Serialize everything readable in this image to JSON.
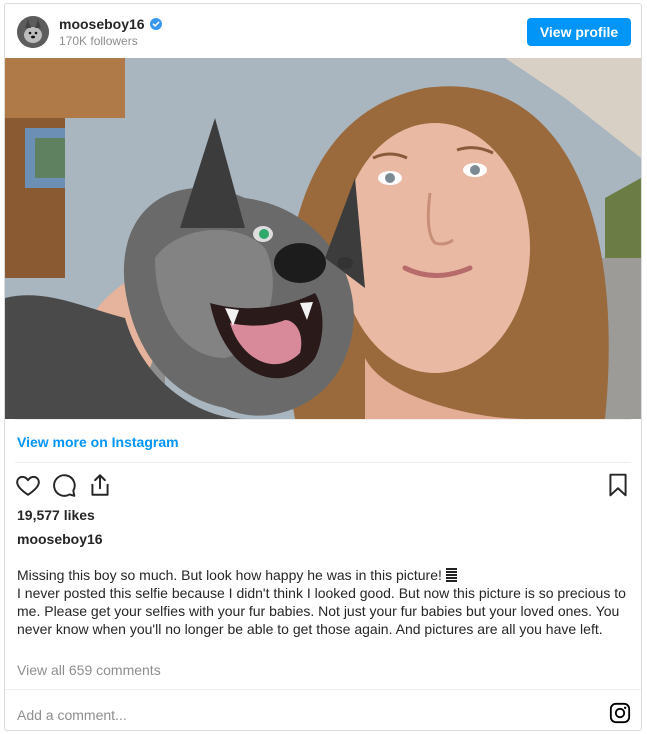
{
  "post": {
    "username": "mooseboy16",
    "followers": "170K followers",
    "view_profile_label": "View profile",
    "view_more_label": "View more on Instagram",
    "likes": "19,577 likes",
    "caption_username": "mooseboy16",
    "caption_line1": "Missing this boy so much. But look how happy he was in this picture!",
    "caption_body": "I never posted this selfie because I didn't think I looked good. But now this picture is so precious to me. Please get your selfies with your fur babies. Not just your fur babies but your loved ones. You never know when you'll no longer be able to get those again. And pictures are all you have left.",
    "view_comments_label": "View all 659 comments",
    "add_comment_placeholder": "Add a comment..."
  },
  "icons": {
    "like": "heart-icon",
    "comment": "comment-icon",
    "share": "share-icon",
    "save": "bookmark-icon",
    "instagram": "instagram-icon",
    "verified": "verified-badge-icon"
  },
  "colors": {
    "accent": "#0095f6",
    "text": "#262626",
    "muted": "#8e8e8e",
    "border": "#dbdbdb"
  }
}
